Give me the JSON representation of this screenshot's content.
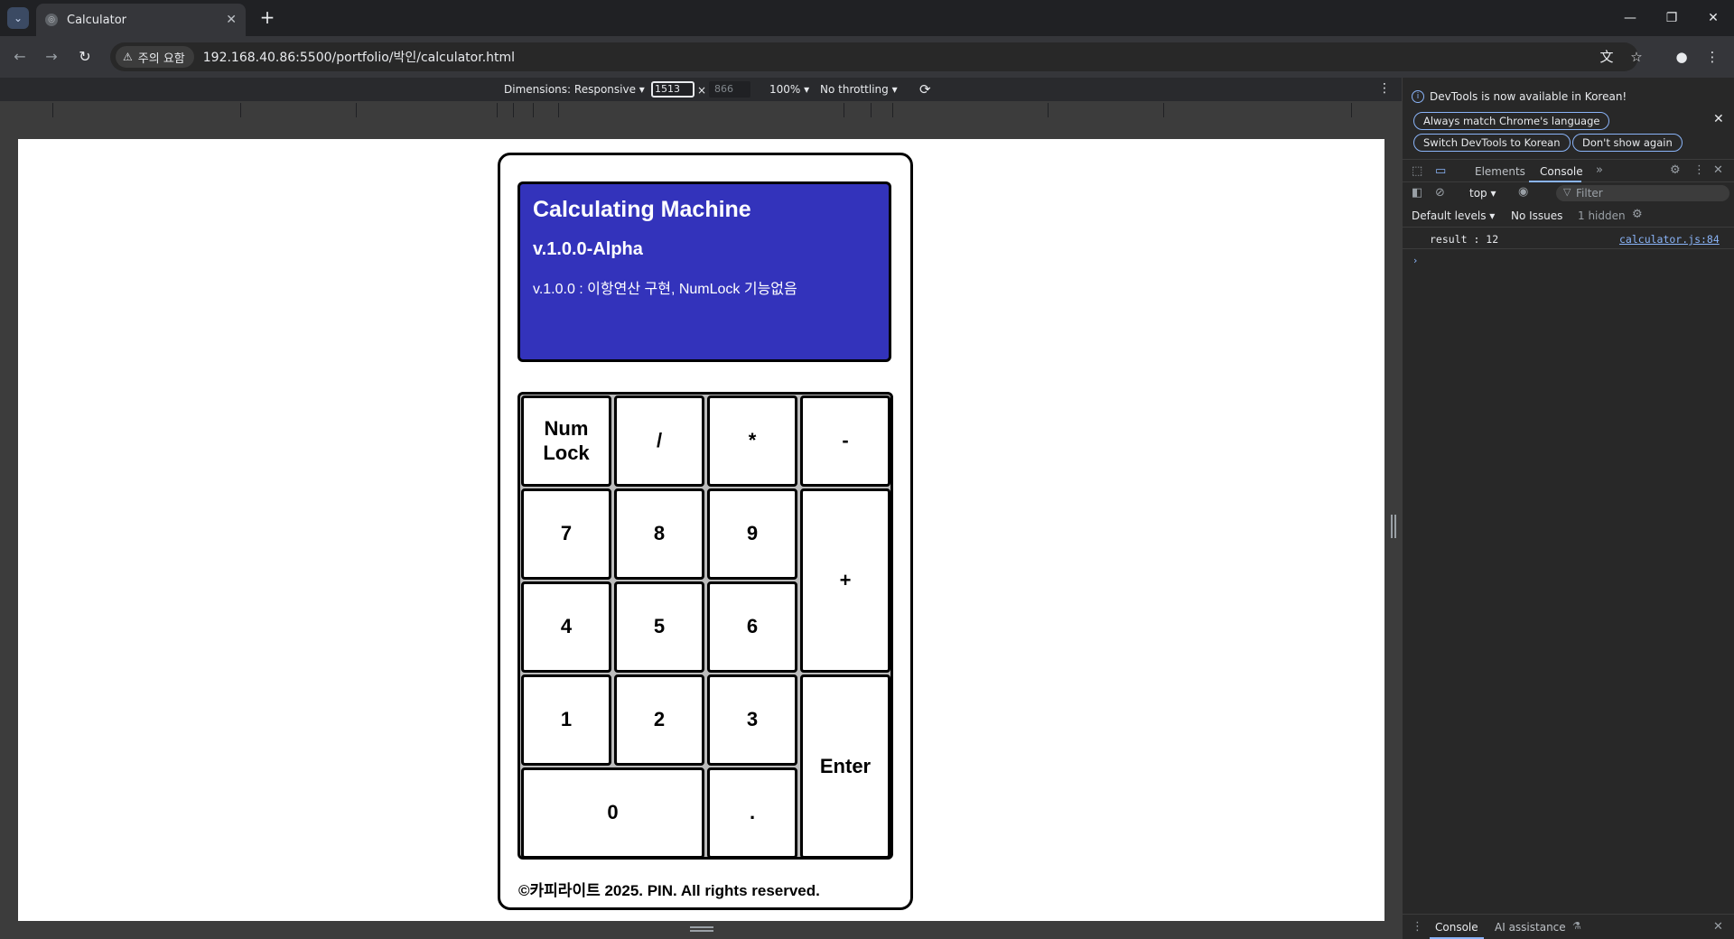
{
  "browser": {
    "tab_title": "Calculator",
    "new_tab": "+",
    "security_label": "주의 요함",
    "url": "192.168.40.86:5500/portfolio/박인/calculator.html"
  },
  "device_toolbar": {
    "dimensions_label": "Dimensions: Responsive ▾",
    "width": "1513",
    "times": "×",
    "height": "866",
    "zoom": "100% ▾",
    "throttling": "No throttling ▾"
  },
  "calculator": {
    "title": "Calculating Machine",
    "version": "v.1.0.0-Alpha",
    "note": "v.1.0.0 : 이항연산 구현, NumLock 기능없음",
    "keys": {
      "numlock": "Num Lock",
      "divide": "/",
      "multiply": "*",
      "minus": "-",
      "k7": "7",
      "k8": "8",
      "k9": "9",
      "plus": "+",
      "k4": "4",
      "k5": "5",
      "k6": "6",
      "k1": "1",
      "k2": "2",
      "k3": "3",
      "enter": "Enter",
      "k0": "0",
      "dot": "."
    },
    "footer": "©카피라이트 2025. PIN. All rights reserved."
  },
  "devtools": {
    "banner_text": "DevTools is now available in Korean!",
    "btn_match": "Always match Chrome's language",
    "btn_switch": "Switch DevTools to Korean",
    "btn_dont_show": "Don't show again",
    "tab_elements": "Elements",
    "tab_console": "Console",
    "context": "top ▾",
    "filter_placeholder": "Filter",
    "default_levels": "Default levels ▾",
    "no_issues": "No Issues",
    "hidden": "1 hidden",
    "log_message": "result : 12",
    "log_source": "calculator.js:84",
    "drawer_console": "Console",
    "drawer_ai": "AI assistance"
  }
}
